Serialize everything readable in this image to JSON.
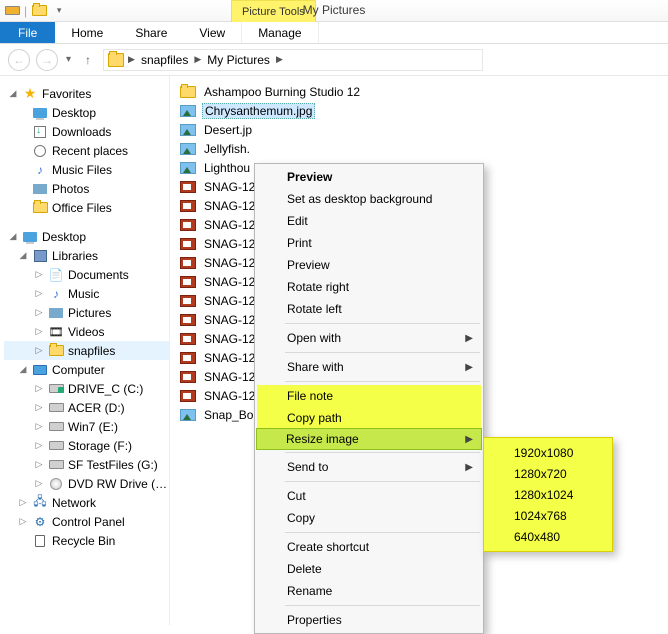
{
  "window": {
    "title": "My Pictures"
  },
  "ribbon": {
    "context_group": "Picture Tools",
    "tabs": {
      "file": "File",
      "home": "Home",
      "share": "Share",
      "view": "View",
      "manage": "Manage"
    }
  },
  "breadcrumb": {
    "seg1": "snapfiles",
    "seg2": "My Pictures"
  },
  "tree": {
    "favorites": "Favorites",
    "fav_items": {
      "desktop": "Desktop",
      "downloads": "Downloads",
      "recent": "Recent places",
      "music": "Music Files",
      "photos": "Photos",
      "office": "Office Files"
    },
    "desktop": "Desktop",
    "libraries": "Libraries",
    "lib_items": {
      "documents": "Documents",
      "music": "Music",
      "pictures": "Pictures",
      "videos": "Videos",
      "snapfiles": "snapfiles"
    },
    "computer": "Computer",
    "comp_items": {
      "drivec": "DRIVE_C (C:)",
      "acer": "ACER (D:)",
      "win7": "Win7 (E:)",
      "storage": "Storage (F:)",
      "sftest": "SF TestFiles (G:)",
      "dvd": "DVD RW Drive (…"
    },
    "network": "Network",
    "control": "Control Panel",
    "recycle": "Recycle Bin"
  },
  "files": {
    "folder1": "Ashampoo Burning Studio 12",
    "selected": "Chrysanthemum.jpg",
    "items": [
      "Desert.jp",
      "Jellyfish.",
      "Lighthou",
      "SNAG-12",
      "SNAG-12",
      "SNAG-12",
      "SNAG-12",
      "SNAG-12",
      "SNAG-12",
      "SNAG-12",
      "SNAG-12",
      "SNAG-12",
      "SNAG-12",
      "SNAG-12",
      "SNAG-12"
    ],
    "last": "Snap_Bo"
  },
  "ctx": {
    "preview_bold": "Preview",
    "setbg": "Set as desktop background",
    "edit": "Edit",
    "print": "Print",
    "preview": "Preview",
    "rotr": "Rotate right",
    "rotl": "Rotate left",
    "openwith": "Open with",
    "sharewith": "Share with",
    "filenote": "File note",
    "copypath": "Copy path",
    "resize": "Resize image",
    "sendto": "Send to",
    "cut": "Cut",
    "copy": "Copy",
    "shortcut": "Create shortcut",
    "delete": "Delete",
    "rename": "Rename",
    "properties": "Properties"
  },
  "resize_options": [
    "1920x1080",
    "1280x720",
    "1280x1024",
    "1024x768",
    "640x480"
  ]
}
